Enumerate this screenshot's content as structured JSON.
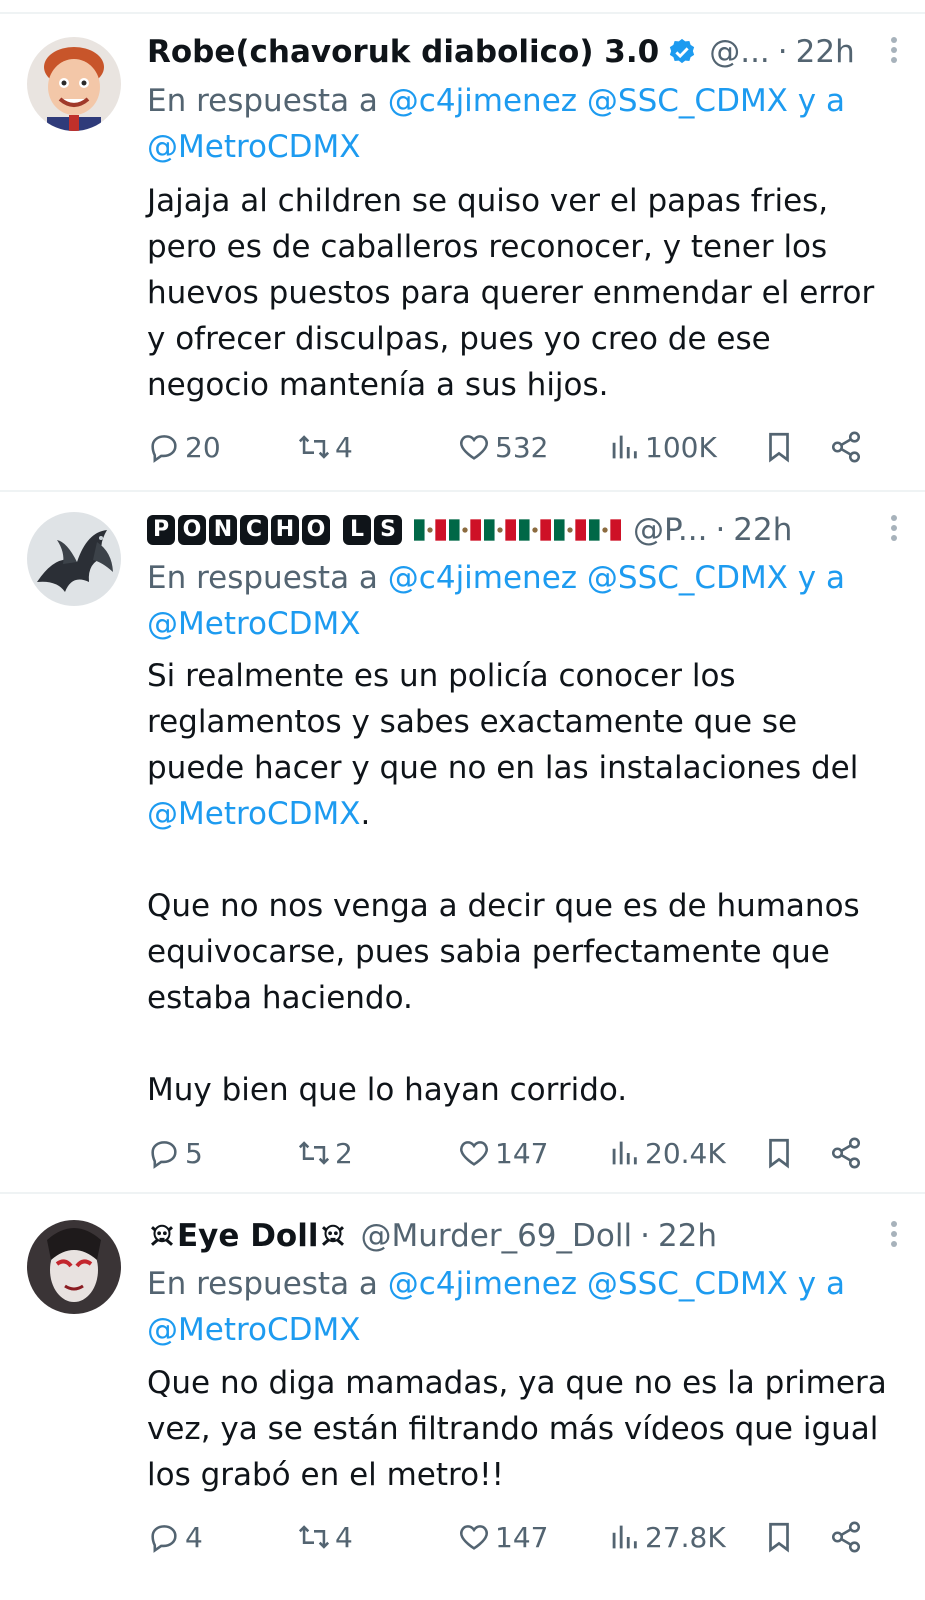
{
  "colors": {
    "link": "#1d9bf0",
    "muted": "#536471",
    "text": "#0f1419",
    "verified": "#1d9bf0"
  },
  "tweets": [
    {
      "name": "Robe(chavoruk diabolico) 3.0",
      "verified": true,
      "handle": "@...",
      "dot": "·",
      "time": "22h",
      "reply_prefix": "En respuesta a",
      "reply_m1": "@c4jimenez",
      "reply_m2": "@SSC_CDMX",
      "reply_and": "y a",
      "reply_m3": "@MetroCDMX",
      "text": "Jajaja al children se quiso ver el papas fries, pero es de caballeros reconocer, y tener los huevos puestos para querer enmendar el error y ofrecer disculpas, pues yo creo de ese negocio mantenía a sus hijos.",
      "replies": "20",
      "reposts": "4",
      "likes": "532",
      "views": "100K",
      "avatar_icon": "toddler-cartoon-avatar"
    },
    {
      "name_letters1": [
        "P",
        "O",
        "N",
        "C",
        "H",
        "O"
      ],
      "name_letters2": [
        "L",
        "S"
      ],
      "flags_icon": "mexico-flag-icon",
      "handle": "@P...",
      "dot": "·",
      "time": "22h",
      "reply_prefix": "En respuesta a",
      "reply_m1": "@c4jimenez",
      "reply_m2": "@SSC_CDMX",
      "reply_and": "y a",
      "reply_m3": "@MetroCDMX",
      "p1_text": "Si realmente es un policía conocer los reglamentos y sabes exactamente que se puede hacer y que no en las instalaciones del",
      "p1_mention": "@MetroCDMX",
      "p1_end": ".",
      "p2": "Que no nos venga a decir que es de humanos equivocarse, pues sabia perfectamente que estaba haciendo.",
      "p3": "Muy bien que lo hayan corrido.",
      "replies": "5",
      "reposts": "2",
      "likes": "147",
      "views": "20.4K",
      "avatar_icon": "dragon-avatar"
    },
    {
      "name": "Eye Doll",
      "name_icon": "skull-crossbones-icon",
      "handle": "@Murder_69_Doll",
      "dot": "·",
      "time": "22h",
      "reply_prefix": "En respuesta a",
      "reply_m1": "@c4jimenez",
      "reply_m2": "@SSC_CDMX",
      "reply_and": "y a",
      "reply_m3": "@MetroCDMX",
      "text": "Que no diga mamadas, ya que no es la primera vez, ya se están filtrando más vídeos que igual los grabó en el metro!!",
      "replies": "4",
      "reposts": "4",
      "likes": "147",
      "views": "27.8K",
      "avatar_icon": "masked-doll-avatar"
    }
  ]
}
